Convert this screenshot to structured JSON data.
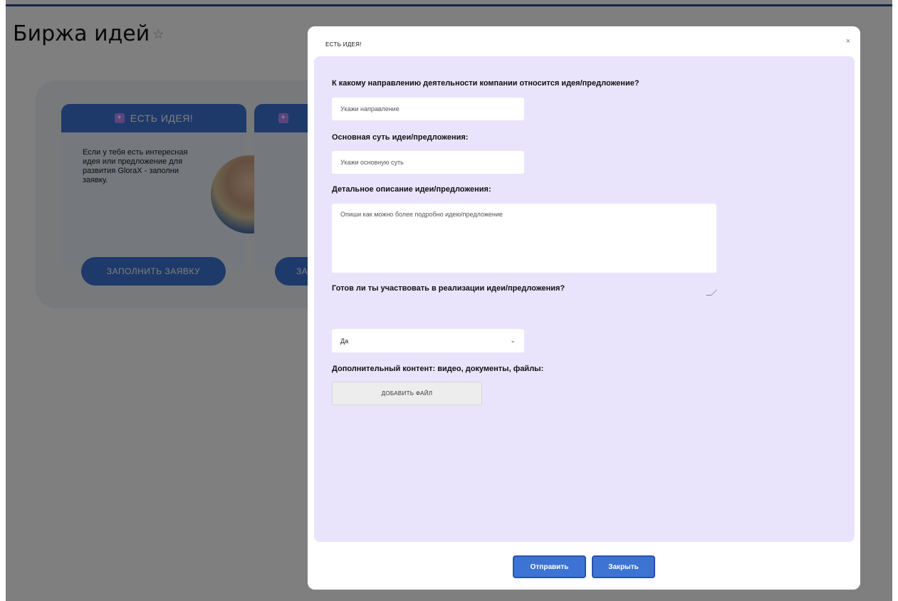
{
  "page": {
    "title": "Биржа идей",
    "star_icon": "star-icon"
  },
  "cards": [
    {
      "header": "ЕСТЬ ИДЕЯ!",
      "icon": "idea-icon",
      "text": "Если у тебя есть интересная идея или предложение для развития GloraX - заполни заявку.",
      "button": "ЗАПОЛНИТЬ ЗАЯВКУ"
    },
    {
      "header": "",
      "icon": "idea-icon",
      "text": "",
      "button": "ЗА"
    }
  ],
  "modal": {
    "title": "ЕСТЬ ИДЕЯ!",
    "close_glyph": "×",
    "fields": {
      "direction": {
        "label": "К какому направлению деятельности компании относится идея/предложение?",
        "placeholder": "Укажи направление"
      },
      "essence": {
        "label": "Основная суть идеи/предложения:",
        "placeholder": "Укажи основную суть"
      },
      "description": {
        "label": "Детальное описание идеи/предложения:",
        "placeholder": "Опиши как можно более подробно идею/предложение"
      },
      "participation": {
        "label": "Готов ли ты участвовать в реализации идеи/предложения?",
        "value": "Да"
      },
      "attachments": {
        "label": "Дополнительный контент: видео, документы, файлы:",
        "button": "ДОБАВИТЬ ФАЙЛ"
      }
    },
    "buttons": {
      "send": "Отправить",
      "close": "Закрыть"
    }
  },
  "colors": {
    "accent": "#3d74d4",
    "form_background": "#e9e4fb",
    "overlay": "rgba(0,0,0,0.5)"
  }
}
